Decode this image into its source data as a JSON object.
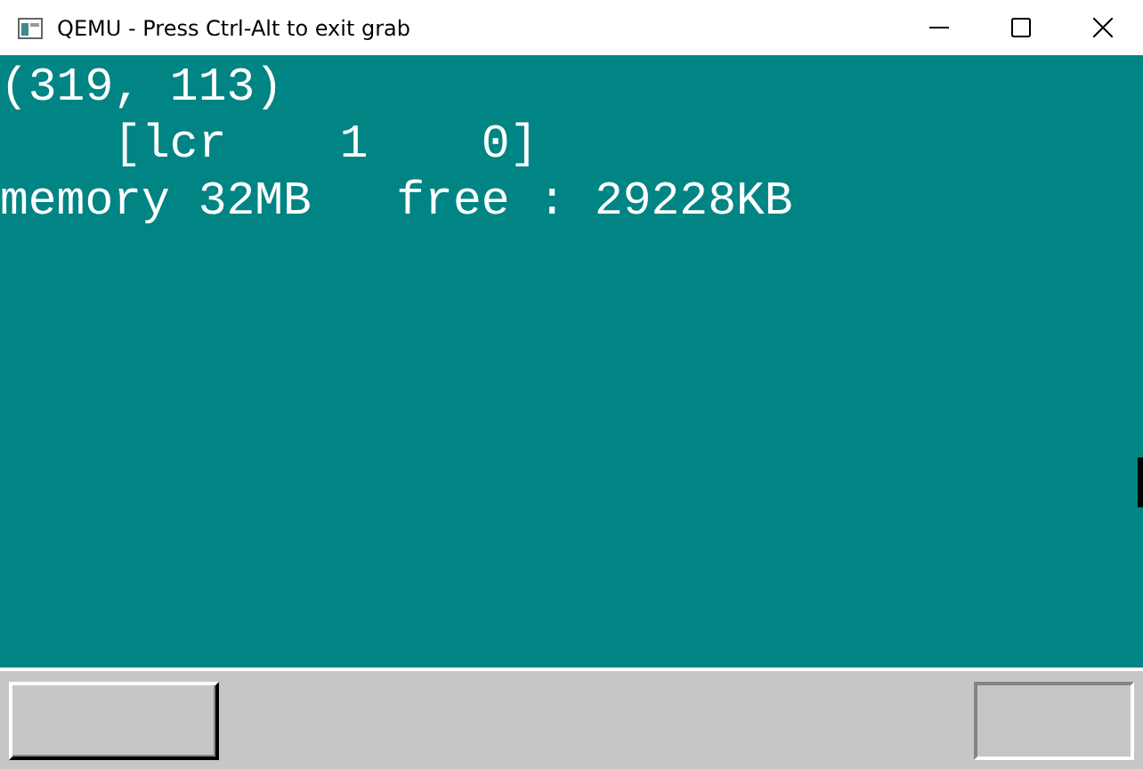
{
  "window": {
    "title": "QEMU - Press Ctrl-Alt to exit grab"
  },
  "screen": {
    "lines": [
      "(319, 113)",
      "    [lcr    1    0]",
      "memory 32MB   free : 29228KB"
    ]
  }
}
